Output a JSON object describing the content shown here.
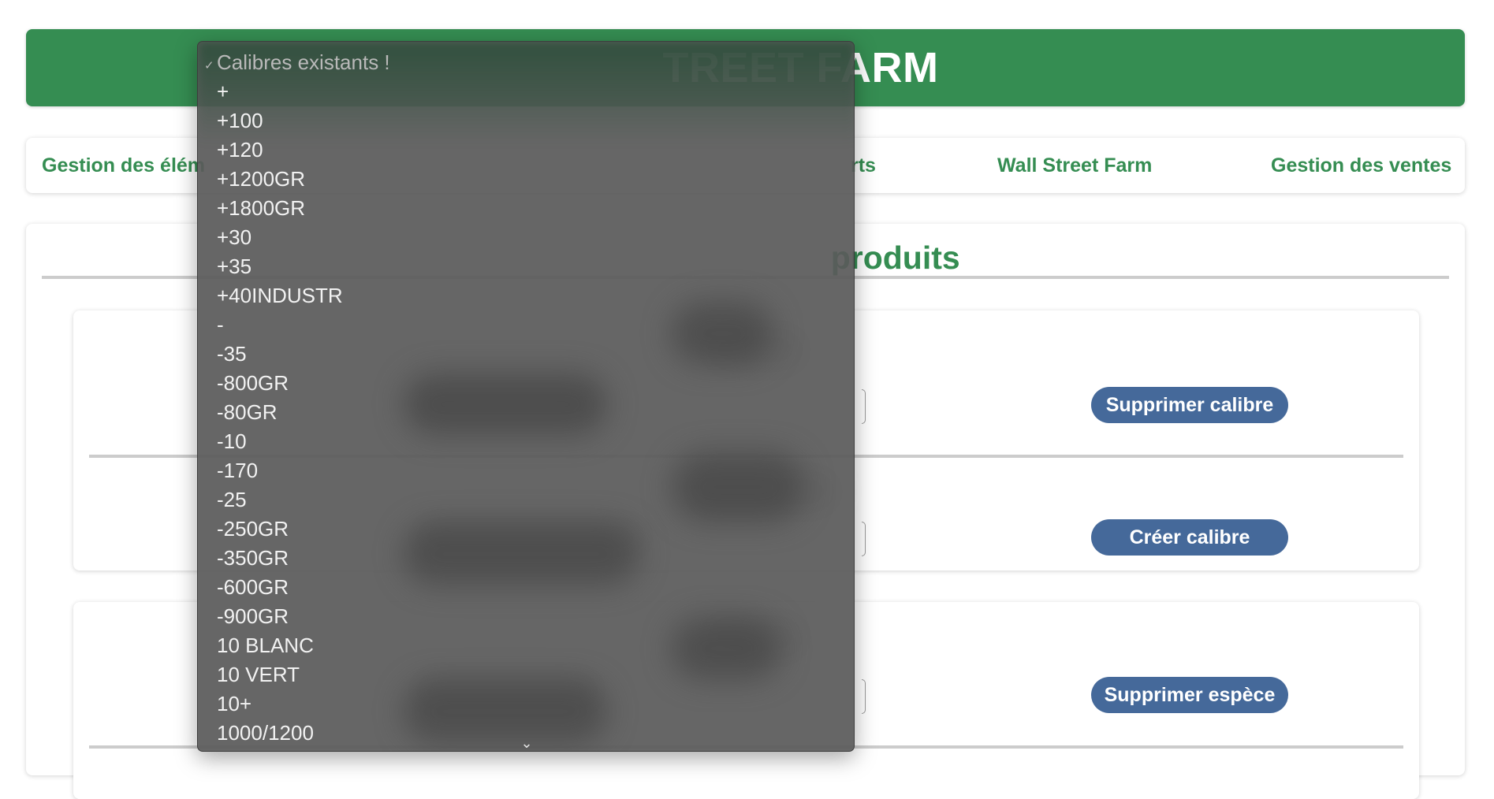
{
  "header": {
    "title": "TREET FARM"
  },
  "nav": {
    "items": [
      {
        "label": "Gestion des élém"
      },
      {
        "label": "rts"
      },
      {
        "label": "Wall Street Farm"
      },
      {
        "label": "Gestion des ventes"
      }
    ]
  },
  "main": {
    "title_visible": "produits",
    "cards": {
      "calibre": {
        "delete_button": "Supprimer calibre",
        "create_button": "Créer calibre"
      },
      "espece": {
        "delete_button": "Supprimer espèce"
      }
    }
  },
  "dropdown": {
    "placeholder_check": "✓",
    "placeholder": "Calibres existants !",
    "options": [
      "+",
      "+100",
      "+120",
      "+1200GR",
      "+1800GR",
      "+30",
      "+35",
      "+40INDUSTR",
      "-",
      "-35",
      "-800GR",
      "-80GR",
      "-10",
      "-170",
      "-25",
      "-250GR",
      "-350GR",
      "-600GR",
      "-900GR",
      "10 BLANC",
      "10 VERT",
      "10+",
      "1000/1200"
    ],
    "more_indicator": "⌄"
  },
  "colors": {
    "brand_green": "#358d52",
    "button_blue": "#45699a",
    "dropdown_bg": "#5a5a5a"
  }
}
